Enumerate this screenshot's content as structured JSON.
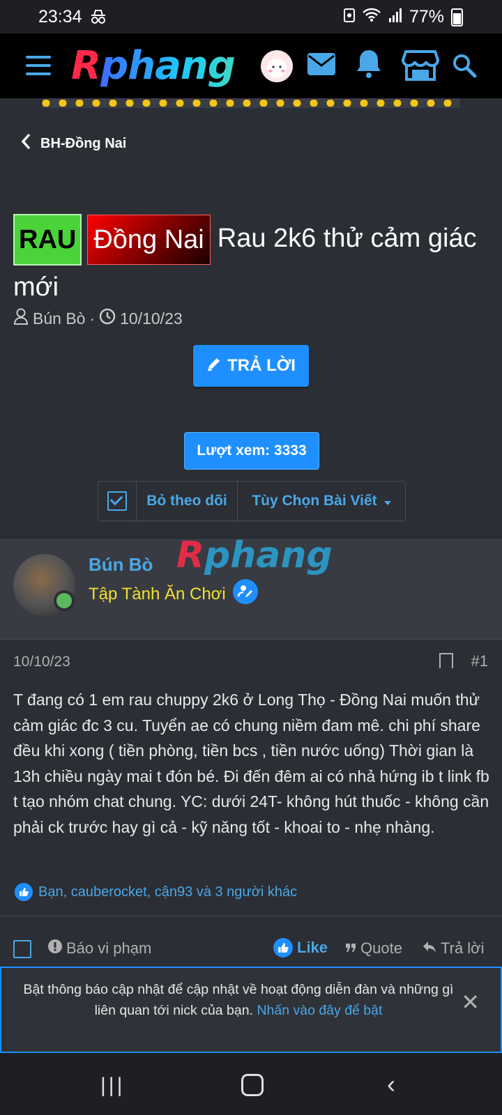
{
  "status_bar": {
    "time": "23:34",
    "battery": "77%"
  },
  "navbar": {
    "logo_first": "R",
    "logo_rest": "phang"
  },
  "breadcrumb": {
    "label": "BH-Đồng Nai"
  },
  "thread": {
    "prefix1": "RAU",
    "prefix2": "Đồng Nai",
    "title": "Rau 2k6 thử cảm giác mới",
    "author": "Bún Bò",
    "date": "10/10/23",
    "reply_button": "TRẢ LỜI",
    "views": "Lượt xem: 3333",
    "unwatch": "Bỏ theo dõi",
    "options": "Tùy Chọn Bài Viết"
  },
  "post": {
    "author": "Bún Bò",
    "user_title": "Tập Tành Ăn Chơi",
    "watermark_first": "R",
    "watermark_rest": "phang",
    "date": "10/10/23",
    "number": "#1",
    "body": "T đang có 1 em rau chuppy 2k6 ở Long Thọ - Đồng Nai muốn thử cảm giác đc 3 cu. Tuyển ae có chung niềm đam mê. chi phí share đều khi xong ( tiền phòng, tiền bcs , tiền nước uống) Thời gian là 13h chiều ngày mai t đón bé. Đi đến đêm ai có nhả hứng ib t link fb t tạo nhóm chat chung. YC: dưới 24T- không hút thuốc - không cần phải ck trước hay gì cả - kỹ năng tốt - khoai to - nhẹ nhàng.",
    "reactions": "Bạn, cauberocket, cận93 và 3 người khác",
    "report": "Báo vi phạm",
    "like": "Like",
    "quote": "Quote",
    "reply": "Trả lời"
  },
  "notice": {
    "text": "Bật thông báo cập nhật để cập nhật về hoạt động diễn đàn và những gì liên quan tới nick của bạn.",
    "link": "Nhấn vào đây để bật"
  },
  "colors": {
    "accent": "#1f8fff",
    "link": "#4aa8e8",
    "background": "#2b2e34",
    "user_title": "#f0e130"
  }
}
